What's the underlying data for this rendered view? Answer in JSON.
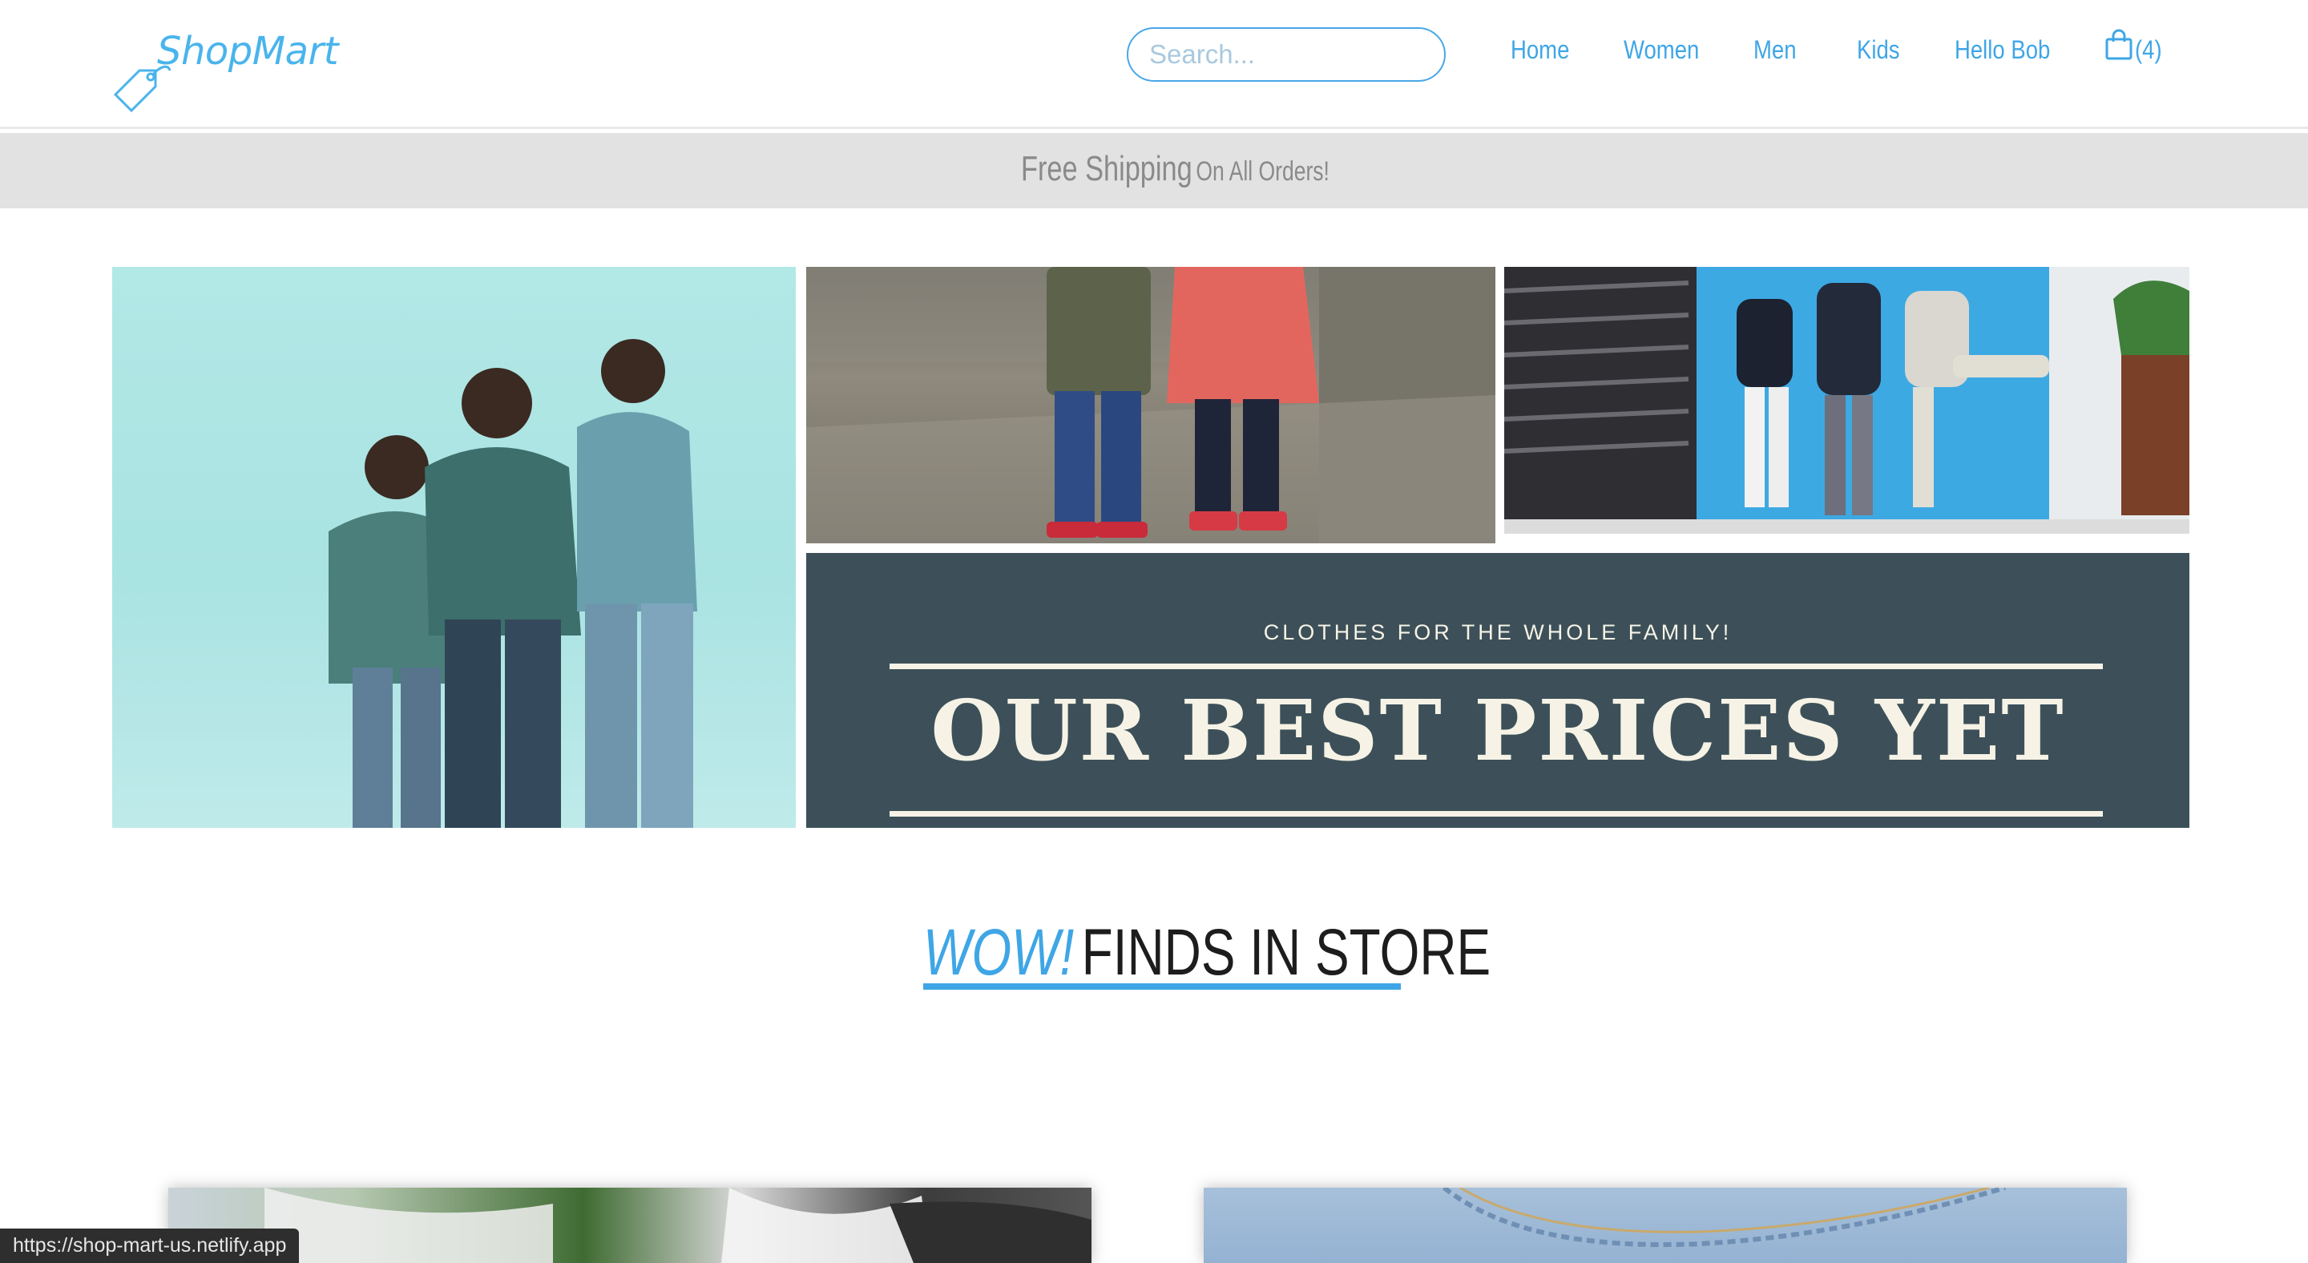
{
  "brand": {
    "name": "ShopMart",
    "logo_icon": "price-tag-icon",
    "color": "#4ab4ec"
  },
  "search": {
    "placeholder": "Search..."
  },
  "nav": {
    "items": [
      {
        "label": "Home"
      },
      {
        "label": "Women"
      },
      {
        "label": "Men"
      },
      {
        "label": "Kids"
      },
      {
        "label": "Hello Bob"
      }
    ],
    "cart": {
      "icon": "shopping-bag-icon",
      "count": "(4)"
    },
    "link_color": "#3fa6e6"
  },
  "shipping_banner": {
    "big": "Free Shipping",
    "small": "On All Orders!",
    "background": "#e2e2e2"
  },
  "hero": {
    "tiles": [
      {
        "name": "men-photo"
      },
      {
        "name": "kids-photo"
      },
      {
        "name": "sportswear-photo"
      }
    ],
    "promo": {
      "eyebrow": "CLOTHES FOR THE WHOLE FAMILY!",
      "title": "OUR BEST PRICES YET",
      "background": "#3d5059"
    }
  },
  "section": {
    "accent": "WOW!",
    "title": "FINDS IN STORE"
  },
  "products": [
    {
      "name": "sneakers-card"
    },
    {
      "name": "jeans-card"
    }
  ],
  "status_bar": {
    "url": "https://shop-mart-us.netlify.app"
  }
}
